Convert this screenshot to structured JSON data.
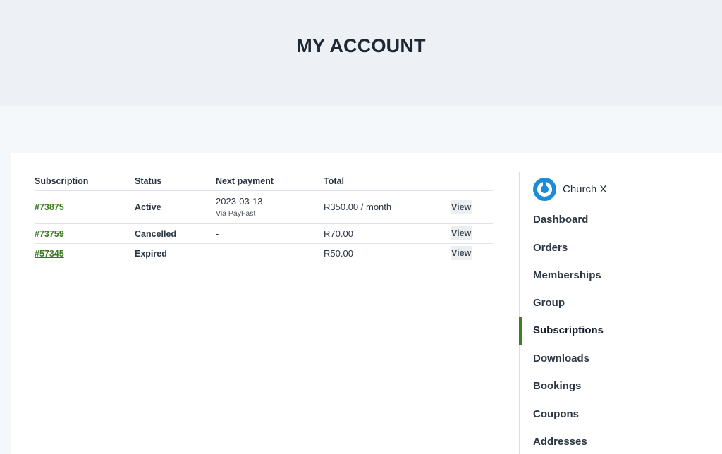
{
  "page": {
    "title": "MY ACCOUNT"
  },
  "table": {
    "headers": [
      "Subscription",
      "Status",
      "Next payment",
      "Total",
      ""
    ],
    "rows": [
      {
        "id": "#73875",
        "status": "Active",
        "next_payment": "2023-03-13",
        "next_payment_note": "Via PayFast",
        "total": "R350.00 / month",
        "action": "View"
      },
      {
        "id": "#73759",
        "status": "Cancelled",
        "next_payment": "-",
        "next_payment_note": "",
        "total": "R70.00",
        "action": "View"
      },
      {
        "id": "#57345",
        "status": "Expired",
        "next_payment": "-",
        "next_payment_note": "",
        "total": "R50.00",
        "action": "View"
      }
    ]
  },
  "sidebar": {
    "account_name": "Church X",
    "logo_icon": "power-logo-icon",
    "accent_color": "#3d7f26",
    "logo_color": "#1a8cd8",
    "items": [
      {
        "label": "Dashboard",
        "active": false
      },
      {
        "label": "Orders",
        "active": false
      },
      {
        "label": "Memberships",
        "active": false
      },
      {
        "label": "Group",
        "active": false
      },
      {
        "label": "Subscriptions",
        "active": true
      },
      {
        "label": "Downloads",
        "active": false
      },
      {
        "label": "Bookings",
        "active": false
      },
      {
        "label": "Coupons",
        "active": false
      },
      {
        "label": "Addresses",
        "active": false
      }
    ]
  }
}
